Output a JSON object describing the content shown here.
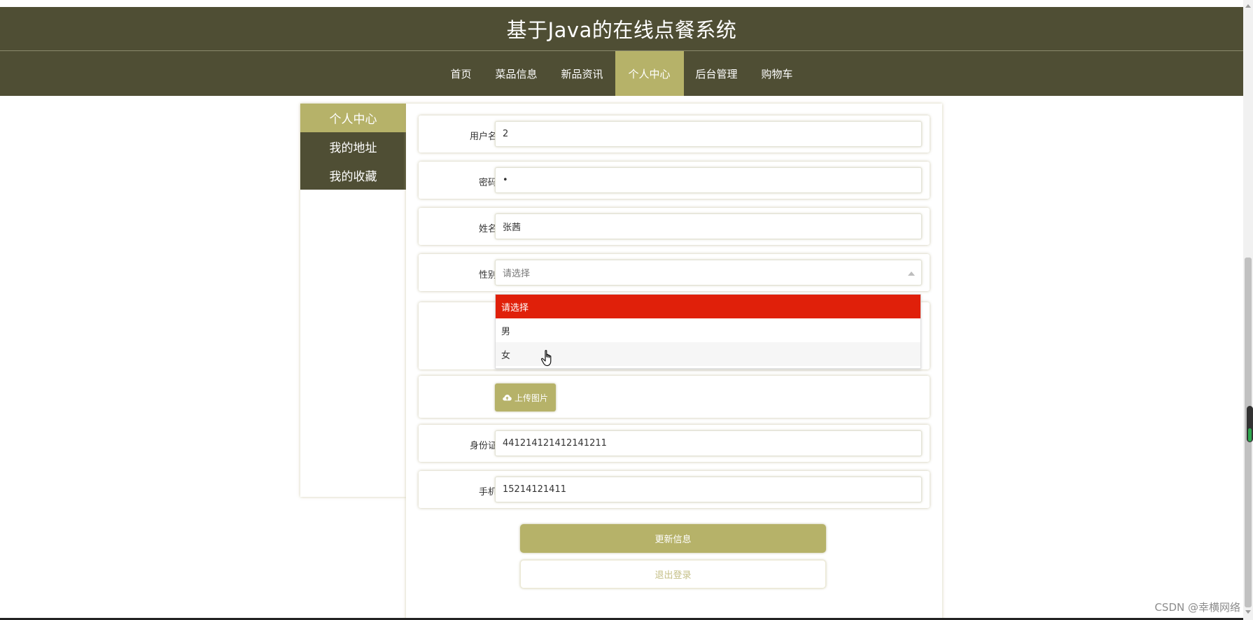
{
  "header": {
    "title": "基于Java的在线点餐系统"
  },
  "nav": {
    "items": [
      {
        "label": "首页"
      },
      {
        "label": "菜品信息"
      },
      {
        "label": "新品资讯"
      },
      {
        "label": "个人中心"
      },
      {
        "label": "后台管理"
      },
      {
        "label": "购物车"
      }
    ],
    "active": "个人中心"
  },
  "sidebar": {
    "items": [
      {
        "label": "个人中心"
      },
      {
        "label": "我的地址"
      },
      {
        "label": "我的收藏"
      }
    ]
  },
  "form": {
    "username": {
      "label": "用户名",
      "value": "2"
    },
    "password": {
      "label": "密码",
      "value": "•"
    },
    "name": {
      "label": "姓名",
      "value": "张茜"
    },
    "gender": {
      "label": "性别",
      "value": "请选择",
      "options": [
        "请选择",
        "男",
        "女"
      ]
    },
    "upload_label": "上传图片",
    "idcard": {
      "label": "身份证",
      "value": "441214121412141211"
    },
    "phone": {
      "label": "手机",
      "value": "15214121411"
    }
  },
  "actions": {
    "update": "更新信息",
    "logout": "退出登录"
  },
  "watermark": "CSDN @幸横网络",
  "colors": {
    "dark": "#4f4e34",
    "accent": "#b6b269",
    "selected_option": "#e0200a"
  }
}
